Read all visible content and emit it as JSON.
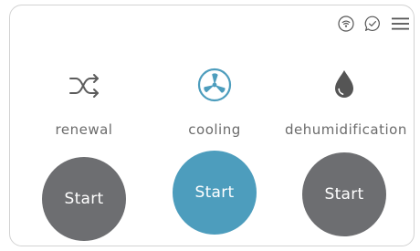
{
  "topbar": {
    "icons": [
      "wifi-icon",
      "chat-check-icon",
      "menu-icon"
    ]
  },
  "modes": [
    {
      "label": "renewal",
      "button_label": "Start",
      "icon": "shuffle-icon",
      "active": false
    },
    {
      "label": "cooling",
      "button_label": "Start",
      "icon": "fan-icon",
      "active": true
    },
    {
      "label": "dehumidification",
      "button_label": "Start",
      "icon": "water-drop-icon",
      "active": false
    }
  ],
  "colors": {
    "inactive_button": "#6d6e71",
    "active_button": "#4d9dbd",
    "icon_gray": "#5c5c5c",
    "active_icon": "#4d9dbd",
    "label_gray": "#6b6b6b",
    "card_border": "#d2d2d2"
  }
}
